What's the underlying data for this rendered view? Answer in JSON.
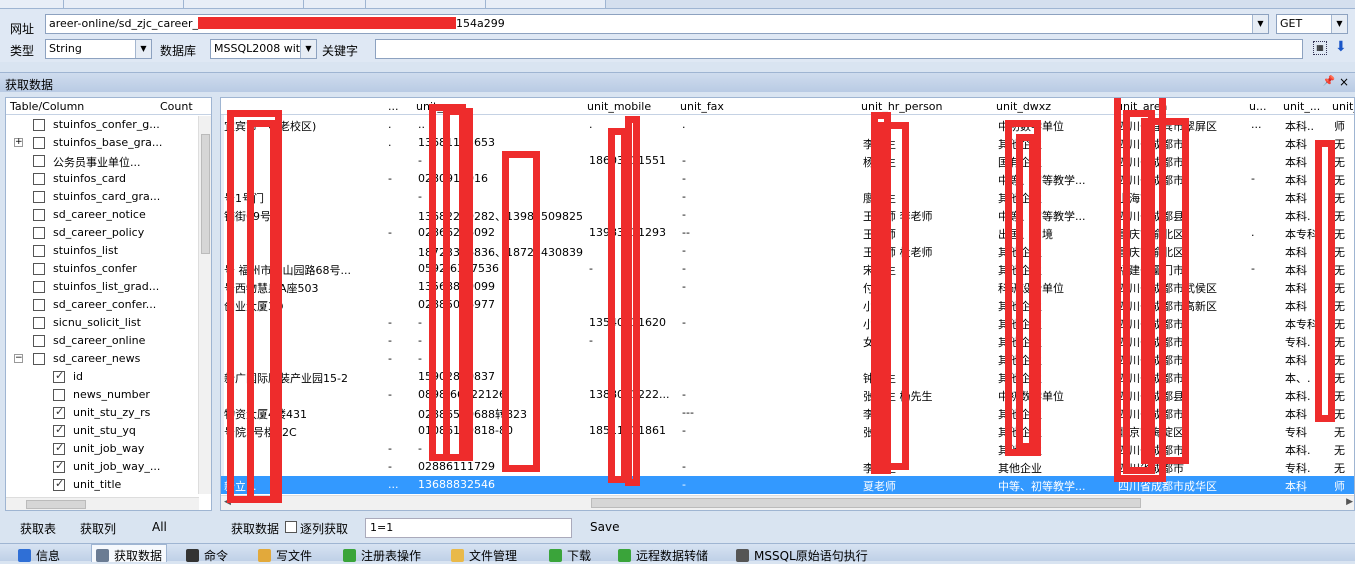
{
  "toolbar": {
    "url_label": "网址",
    "url_value_prefix": "areer-online/sd_zjc_career_",
    "url_value_suffix": "154a299",
    "method": "GET",
    "type_label": "类型",
    "type_value": "String",
    "db_label": "数据库",
    "db_value": "MSSQL2008 with l",
    "keyword_label": "关键字",
    "keyword_value": ""
  },
  "panel": {
    "title": "获取数据",
    "pin": "ㅁ",
    "close": "×"
  },
  "tree": {
    "col_table": "Table/Column",
    "col_count": "Count",
    "items": [
      {
        "label": "stuinfos_confer_g...",
        "checked": false,
        "expander": "",
        "indent": 0
      },
      {
        "label": "stuinfos_base_gra...",
        "checked": false,
        "expander": "+",
        "indent": 0
      },
      {
        "label": "公务员事业单位...",
        "checked": false,
        "expander": "",
        "indent": 0
      },
      {
        "label": "stuinfos_card",
        "checked": false,
        "expander": "",
        "indent": 0
      },
      {
        "label": "stuinfos_card_gra...",
        "checked": false,
        "expander": "",
        "indent": 0
      },
      {
        "label": "sd_career_notice",
        "checked": false,
        "expander": "",
        "indent": 0
      },
      {
        "label": "sd_career_policy",
        "checked": false,
        "expander": "",
        "indent": 0
      },
      {
        "label": "stuinfos_list",
        "checked": false,
        "expander": "",
        "indent": 0
      },
      {
        "label": "stuinfos_confer",
        "checked": false,
        "expander": "",
        "indent": 0
      },
      {
        "label": "stuinfos_list_grad...",
        "checked": false,
        "expander": "",
        "indent": 0
      },
      {
        "label": "sd_career_confer...",
        "checked": false,
        "expander": "",
        "indent": 0
      },
      {
        "label": "sicnu_solicit_list",
        "checked": false,
        "expander": "",
        "indent": 0
      },
      {
        "label": "sd_career_online",
        "checked": false,
        "expander": "",
        "indent": 0
      },
      {
        "label": "sd_career_news",
        "checked": false,
        "expander": "−",
        "indent": 0
      },
      {
        "label": "id",
        "checked": true,
        "expander": "",
        "indent": 1
      },
      {
        "label": "news_number",
        "checked": false,
        "expander": "",
        "indent": 1
      },
      {
        "label": "unit_stu_zy_rs",
        "checked": true,
        "expander": "",
        "indent": 1
      },
      {
        "label": "unit_stu_yq",
        "checked": true,
        "expander": "",
        "indent": 1
      },
      {
        "label": "unit_job_way",
        "checked": true,
        "expander": "",
        "indent": 1
      },
      {
        "label": "unit_job_way_...",
        "checked": true,
        "expander": "",
        "indent": 1
      },
      {
        "label": "unit_title",
        "checked": true,
        "expander": "",
        "indent": 1
      }
    ],
    "footer": {
      "get_table": "获取表",
      "get_column": "获取列",
      "all": "All"
    }
  },
  "grid": {
    "columns": [
      "...",
      "unit_...",
      "unit_mobile",
      "unit_fax",
      "unit_hr_person",
      "unit_dwxz",
      "unit_area",
      "u...",
      "unit_...",
      "unit_..."
    ],
    "rows": [
      [
        "宜宾市一中老校区)",
        ".",
        "..",
        ".",
        ".",
        "",
        "中初数学单位",
        "四川省宜宾市翠屏区",
        "...",
        "本科..",
        "师"
      ],
      [
        "",
        ".",
        "13681133653",
        "",
        "",
        "李先生",
        "其他企业",
        "四川省成都市",
        "",
        "本科",
        "无"
      ],
      [
        "",
        "",
        "-",
        "18603011551",
        "-",
        "杨先生",
        "国有企业",
        "四川省成都市",
        "",
        "本科",
        "无"
      ],
      [
        "",
        "-",
        "0280915016",
        "",
        "-",
        "",
        "中等、初等教学...",
        "四川省成都市",
        "-",
        "本科",
        "无"
      ],
      [
        "号1号门",
        "",
        "-",
        "",
        "-",
        "廖先生",
        "其他企业",
        "上海市",
        "",
        "本科",
        "无"
      ],
      [
        "铺街69号",
        "",
        "13682269282、13982509825",
        "",
        "-",
        "王老师  李老师",
        "中等、初等教学...",
        "四川省成都县",
        "",
        "本科.",
        "无"
      ],
      [
        "",
        "-",
        "02866256092",
        "13983011293",
        "--",
        "王老师",
        "出国、出境",
        "重庆市渝北区",
        ".",
        "本专科",
        "无"
      ],
      [
        "",
        "",
        "18723366836、18723430839",
        "",
        "-",
        "王老师  杜老师",
        "其他企业",
        "重庆市渝北区",
        "",
        "本科",
        "无"
      ],
      [
        "号 福州市洪山园路68号...",
        "",
        "0592-6307536",
        "-",
        "-",
        "宋先生",
        "其他企业",
        "福建省厦门市",
        "-",
        "本科",
        "无"
      ],
      [
        "号西物慧泉A座503",
        "",
        "13568800099",
        "",
        "-",
        "付丽",
        "科研设计单位",
        "四川省成都市武侯区",
        "",
        "本科",
        "无"
      ],
      [
        "创业大厦3D",
        "",
        "02885026977",
        "",
        "",
        "小姐",
        "其他企业",
        "四川省成都市高新区",
        "",
        "本科",
        "无"
      ],
      [
        "",
        "-",
        "-",
        "13540011620",
        "-",
        "小姐",
        "其他企业",
        "四川省成都市",
        "",
        "本专科",
        "无"
      ],
      [
        "",
        "-",
        "-",
        "-",
        "",
        "女士",
        "其他企业",
        "四川省成都市",
        "",
        "专科.",
        "无"
      ],
      [
        "",
        "-",
        "-",
        "",
        "",
        "",
        "其他企业",
        "四川省成都市",
        "",
        "本科",
        "无"
      ],
      [
        "新广国际服装产业园15-2",
        "",
        "15902810837",
        "",
        "",
        "钟先生",
        "其他企业",
        "四川省成都市",
        "",
        "本、.",
        "无"
      ],
      [
        "",
        "-",
        "0898-66222126",
        "1388011222...",
        "-",
        "张先生  杨先生",
        "中初数学单位",
        "四川省成都县",
        "",
        "本科.",
        "无"
      ],
      [
        "物资大厦4楼431",
        "",
        "02886520688转823",
        "",
        "---",
        "李梅",
        "其他企业",
        "四川省成都市",
        "",
        "本科",
        "无"
      ],
      [
        "号院3号楼22C",
        "",
        "01086159818-80",
        "18511011861",
        "-",
        "张姐",
        "其他企业",
        "北京市海淀区",
        "",
        "专科",
        "无"
      ],
      [
        "",
        "-",
        "-",
        "",
        "",
        "",
        "其他企业",
        "四川省成都市",
        "",
        "本科.",
        "无"
      ],
      [
        "",
        "-",
        "02886111729",
        "",
        "-",
        "李先生",
        "其他企业",
        "四川省成都市",
        "",
        "专科.",
        "无"
      ],
      [
        "新立...",
        "...",
        "13688832546",
        "",
        "-",
        "夏老师",
        "中等、初等教学...",
        "四川省成都市成华区",
        "",
        "本科",
        "师"
      ]
    ],
    "selected_row": 20,
    "footer": {
      "get_data": "获取数据",
      "per_column": "逐列获取",
      "filter": "1=1",
      "save": "Save"
    }
  },
  "statusbar": {
    "items": [
      {
        "label": "信息",
        "icon": "info-icon",
        "color": "#2f6fd6"
      },
      {
        "label": "获取数据",
        "icon": "database-icon",
        "color": "#6b7c93"
      },
      {
        "label": "命令",
        "icon": "terminal-icon",
        "color": "#333333"
      },
      {
        "label": "写文件",
        "icon": "write-file-icon",
        "color": "#e2a93b"
      },
      {
        "label": "注册表操作",
        "icon": "registry-icon",
        "color": "#3aa43a"
      },
      {
        "label": "文件管理",
        "icon": "folder-icon",
        "color": "#e9b949"
      },
      {
        "label": "下载",
        "icon": "download-icon",
        "color": "#3aa43a"
      },
      {
        "label": "远程数据转储",
        "icon": "globe-icon",
        "color": "#3aa43a"
      },
      {
        "label": "MSSQL原始语句执行",
        "icon": "sql-icon",
        "color": "#555555"
      }
    ]
  },
  "colors": {
    "redaction": "#ee2c2c",
    "selection": "#3399ff",
    "chrome": "#dfe8f4"
  }
}
